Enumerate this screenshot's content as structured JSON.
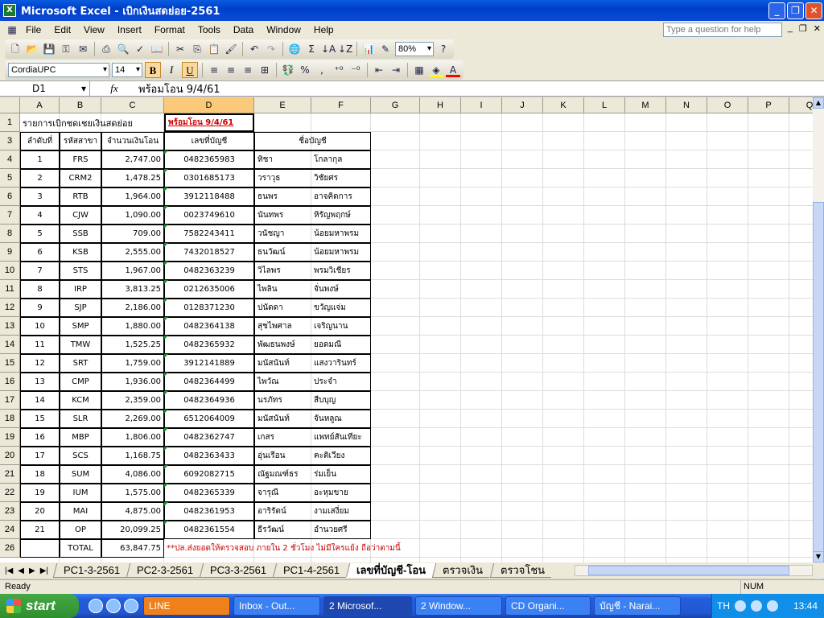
{
  "window": {
    "title": "Microsoft Excel - เบิกเงินสดย่อย-2561"
  },
  "menu": [
    "File",
    "Edit",
    "View",
    "Insert",
    "Format",
    "Tools",
    "Data",
    "Window",
    "Help"
  ],
  "help_placeholder": "Type a question for help",
  "toolbar": {
    "zoom": "80%",
    "font": "CordiaUPC",
    "size": "14",
    "bold": "B",
    "italic": "I",
    "underline": "U",
    "percent": "%",
    "comma": ","
  },
  "formula": {
    "name_box": "D1",
    "fx": "fx",
    "content": "พร้อมโอน  9/4/61"
  },
  "columns": [
    "A",
    "B",
    "C",
    "D",
    "E",
    "F",
    "G",
    "H",
    "I",
    "J",
    "K",
    "L",
    "M",
    "N",
    "O",
    "P",
    "Q",
    "R"
  ],
  "sheet": {
    "a1": "รายการเบิกชดเชยเงินสดย่อย",
    "d1": "พร้อมโอน  9/4/61",
    "headers": [
      "ลำดับที่",
      "รหัสสาขา",
      "จำนวนเงินโอน",
      "เลขที่บัญชี",
      "ชื่อบัญชี"
    ],
    "rows": [
      {
        "r": "4",
        "no": "1",
        "code": "FRS",
        "amt": "2,747.00",
        "acct": "0482365983",
        "first": "ทิชา",
        "last": "โกลากุล"
      },
      {
        "r": "5",
        "no": "2",
        "code": "CRM2",
        "amt": "1,478.25",
        "acct": "0301685173",
        "first": "วราวุธ",
        "last": "วิชัยศร"
      },
      {
        "r": "6",
        "no": "3",
        "code": "RTB",
        "amt": "1,964.00",
        "acct": "3912118488",
        "first": "ธนพร",
        "last": "อาจคิดการ"
      },
      {
        "r": "7",
        "no": "4",
        "code": "CJW",
        "amt": "1,090.00",
        "acct": "0023749610",
        "first": "นันทพร",
        "last": "หิรัญพฤกษ์"
      },
      {
        "r": "8",
        "no": "5",
        "code": "SSB",
        "amt": "709.00",
        "acct": "7582243411",
        "first": "วนัชญา",
        "last": "น้อยมหาพรม"
      },
      {
        "r": "9",
        "no": "6",
        "code": "KSB",
        "amt": "2,555.00",
        "acct": "7432018527",
        "first": "ธนวัฒน์",
        "last": "น้อยมหาพรม"
      },
      {
        "r": "10",
        "no": "7",
        "code": "STS",
        "amt": "1,967.00",
        "acct": "0482363239",
        "first": "วิไลพร",
        "last": "พรมวิเชียร"
      },
      {
        "r": "11",
        "no": "8",
        "code": "IRP",
        "amt": "3,813.25",
        "acct": "0212635006",
        "first": "ไพลิน",
        "last": "จั่นพงษ์"
      },
      {
        "r": "12",
        "no": "9",
        "code": "SJP",
        "amt": "2,186.00",
        "acct": "0128371230",
        "first": "ปนัดดา",
        "last": "ขวัญแจ่ม"
      },
      {
        "r": "13",
        "no": "10",
        "code": "SMP",
        "amt": "1,880.00",
        "acct": "0482364138",
        "first": "สุชไพศาล",
        "last": "เจริญนาน"
      },
      {
        "r": "14",
        "no": "11",
        "code": "TMW",
        "amt": "1,525.25",
        "acct": "0482365932",
        "first": "พัฒธนพงษ์",
        "last": "ยอดมณี"
      },
      {
        "r": "15",
        "no": "12",
        "code": "SRT",
        "amt": "1,759.00",
        "acct": "3912141889",
        "first": "มนัสนันท์",
        "last": "แสงวารินทร์"
      },
      {
        "r": "16",
        "no": "13",
        "code": "CMP",
        "amt": "1,936.00",
        "acct": "0482364499",
        "first": "ไพวัณ",
        "last": "ประจำ"
      },
      {
        "r": "17",
        "no": "14",
        "code": "KCM",
        "amt": "2,359.00",
        "acct": "0482364936",
        "first": "นรภัทร",
        "last": "สืบบุญ"
      },
      {
        "r": "18",
        "no": "15",
        "code": "SLR",
        "amt": "2,269.00",
        "acct": "6512064009",
        "first": "มนัสนันท์",
        "last": "จันหลูณ"
      },
      {
        "r": "19",
        "no": "16",
        "code": "MBP",
        "amt": "1,806.00",
        "acct": "0482362747",
        "first": "เกสร",
        "last": "แพทย์สันเทียะ"
      },
      {
        "r": "20",
        "no": "17",
        "code": "SCS",
        "amt": "1,168.75",
        "acct": "0482363433",
        "first": "อุ่นเรือน",
        "last": "คะติเวียง"
      },
      {
        "r": "21",
        "no": "18",
        "code": "SUM",
        "amt": "4,086.00",
        "acct": "6092082715",
        "first": "ณัฐมณฑ์ธร",
        "last": "ร่มเย็น"
      },
      {
        "r": "22",
        "no": "19",
        "code": "IUM",
        "amt": "1,575.00",
        "acct": "0482365339",
        "first": "จารุณี",
        "last": "อะหุมขาย"
      },
      {
        "r": "23",
        "no": "20",
        "code": "MAI",
        "amt": "4,875.00",
        "acct": "0482361953",
        "first": "อาริรัตน์",
        "last": "งามเสงี่ยม"
      },
      {
        "r": "24",
        "no": "21",
        "code": "OP",
        "amt": "20,099.25",
        "acct": "0482361554",
        "first": "ธีรวัฒน์",
        "last": "อำนวยศรี"
      }
    ],
    "total_label": "TOTAL",
    "total": "63,847.75",
    "note": "**ปล.ส่งยอดให้ตรวจสอบ ภายใน 2 ชั่วโมง ไม่มีใครแย้ง ถือว่าตามนี้",
    "row_headers_top": [
      "1",
      "3"
    ],
    "row_header_total": "26"
  },
  "tabs": [
    "PC1-3-2561",
    "PC2-3-2561",
    "PC3-3-2561",
    "PC1-4-2561",
    "เลขที่บัญชี-โอน",
    "ตรวจเงิน",
    "ตรวจโชน"
  ],
  "active_tab": 4,
  "status": {
    "ready": "Ready",
    "num": "NUM"
  },
  "taskbar": {
    "start": "start",
    "tasks": [
      "LINE",
      "Inbox - Out...",
      "2 Microsof...",
      "2 Window...",
      "CD Organi...",
      "บัญชี - Narai..."
    ],
    "lang": "TH",
    "clock": "13:44"
  }
}
